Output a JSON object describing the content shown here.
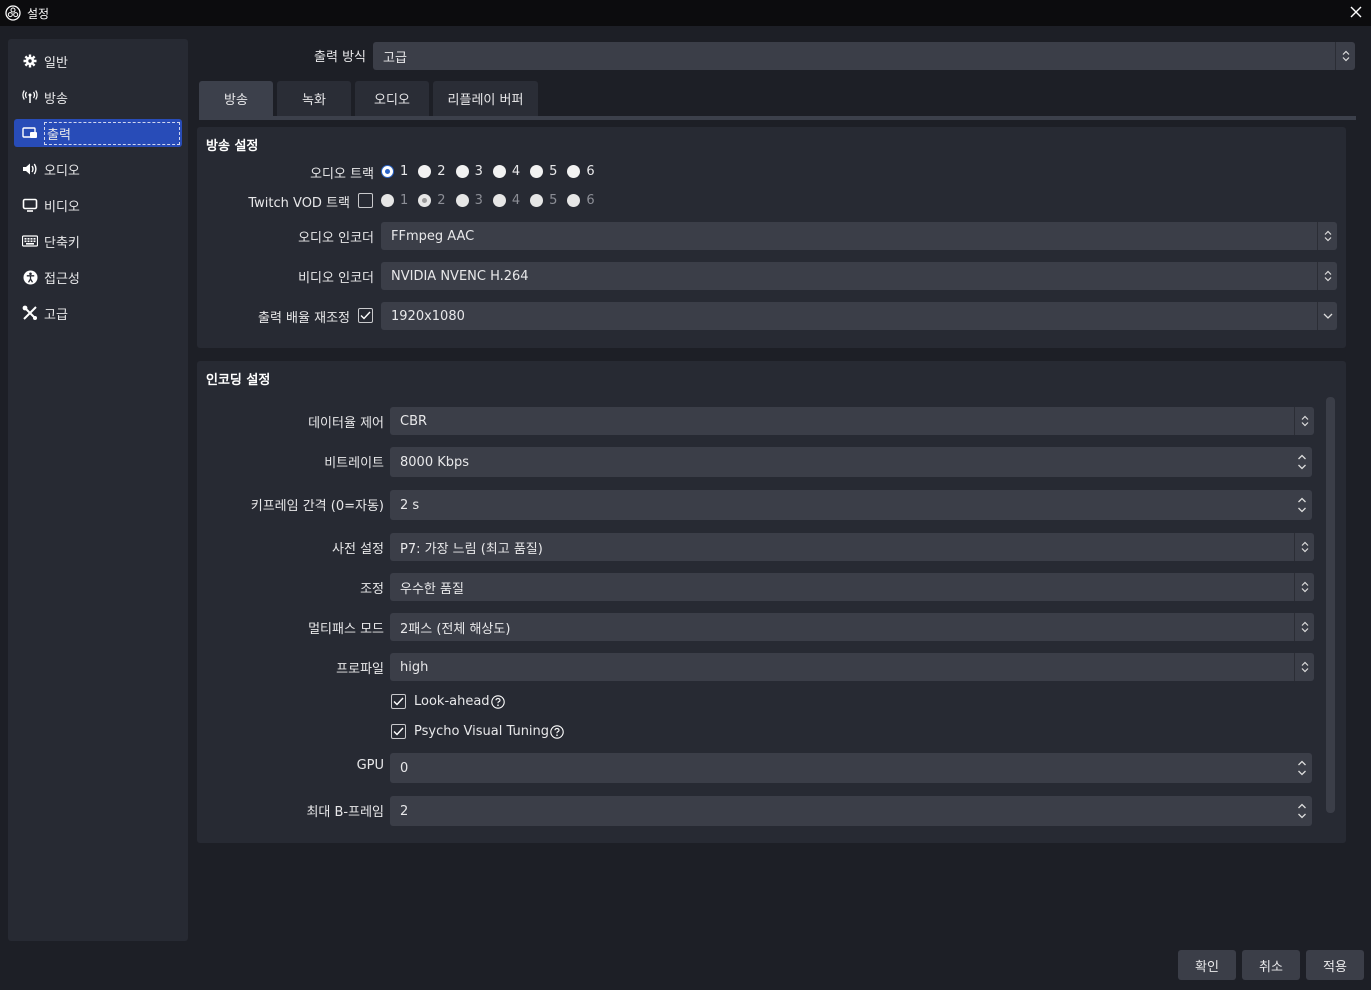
{
  "window": {
    "title": "설정"
  },
  "sidebar": {
    "items": [
      {
        "label": "일반",
        "icon": "gear-icon"
      },
      {
        "label": "방송",
        "icon": "broadcast-icon"
      },
      {
        "label": "출력",
        "icon": "output-icon",
        "active": true
      },
      {
        "label": "오디오",
        "icon": "speaker-icon"
      },
      {
        "label": "비디오",
        "icon": "monitor-icon"
      },
      {
        "label": "단축키",
        "icon": "keyboard-icon"
      },
      {
        "label": "접근성",
        "icon": "accessibility-icon"
      },
      {
        "label": "고급",
        "icon": "tools-icon"
      }
    ]
  },
  "output_mode": {
    "label": "출력 방식",
    "value": "고급"
  },
  "tabs": [
    "방송",
    "녹화",
    "오디오",
    "리플레이 버퍼"
  ],
  "broadcast": {
    "title": "방송 설정",
    "audio_track_label": "오디오 트랙",
    "audio_tracks": [
      "1",
      "2",
      "3",
      "4",
      "5",
      "6"
    ],
    "twitch_vod_label": "Twitch VOD 트랙",
    "twitch_tracks": [
      "1",
      "2",
      "3",
      "4",
      "5",
      "6"
    ],
    "audio_encoder_label": "오디오 인코더",
    "audio_encoder": "FFmpeg AAC",
    "video_encoder_label": "비디오 인코더",
    "video_encoder": "NVIDIA NVENC H.264",
    "rescale_label": "출력 배율 재조정",
    "rescale_value": "1920x1080"
  },
  "encoding": {
    "title": "인코딩 설정",
    "rate_control_label": "데이터율 제어",
    "rate_control": "CBR",
    "bitrate_label": "비트레이트",
    "bitrate": "8000 Kbps",
    "keyframe_label": "키프레임 간격 (0=자동)",
    "keyframe": "2 s",
    "preset_label": "사전 설정",
    "preset": "P7: 가장 느림 (최고 품질)",
    "tuning_label": "조정",
    "tuning": "우수한 품질",
    "multipass_label": "멀티패스 모드",
    "multipass": "2패스 (전체 해상도)",
    "profile_label": "프로파일",
    "profile": "high",
    "lookahead_label": "Look-ahead",
    "psycho_label": "Psycho Visual Tuning",
    "gpu_label": "GPU",
    "gpu": "0",
    "bframes_label": "최대 B-프레임",
    "bframes": "2"
  },
  "buttons": {
    "ok": "확인",
    "cancel": "취소",
    "apply": "적용"
  },
  "colors": {
    "accent": "#284cb8",
    "background": "#1d1f26",
    "panel": "#272a33",
    "field": "#3b3e48"
  }
}
